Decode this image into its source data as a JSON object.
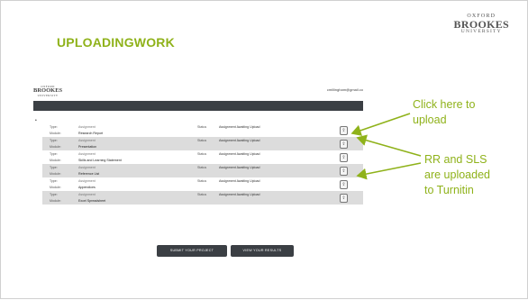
{
  "slide": {
    "title": "UPLOADINGWORK",
    "logo": {
      "line1": "OXFORD",
      "line2": "BROOKES",
      "line3": "UNIVERSITY"
    }
  },
  "screenshot": {
    "logo": {
      "line1": "OXFORD",
      "line2": "BROOKES",
      "line3": "UNIVERSITY"
    },
    "email": "cmillingham@gmail.co",
    "bullet": "•",
    "rows": [
      {
        "type_label": "Type:",
        "type_value": "Assignment",
        "module_label": "Module:",
        "module_value": "Research Report",
        "status_label": "Status",
        "status_value": "Assignment Awaiting Upload"
      },
      {
        "type_label": "Type:",
        "type_value": "Assignment",
        "module_label": "Module:",
        "module_value": "Presentation",
        "status_label": "Status",
        "status_value": "Assignment Awaiting Upload"
      },
      {
        "type_label": "Type:",
        "type_value": "Assignment",
        "module_label": "Module:",
        "module_value": "Skills and Learning Statement",
        "status_label": "Status",
        "status_value": "Assignment Awaiting Upload"
      },
      {
        "type_label": "Type:",
        "type_value": "Assignment",
        "module_label": "Module:",
        "module_value": "Reference List",
        "status_label": "Status",
        "status_value": "Assignment Awaiting Upload"
      },
      {
        "type_label": "Type:",
        "type_value": "Assignment",
        "module_label": "Module:",
        "module_value": "Appendices",
        "status_label": "Status",
        "status_value": "Assignment Awaiting Upload"
      },
      {
        "type_label": "Type:",
        "type_value": "Assignment",
        "module_label": "Module:",
        "module_value": "Excel Spreadsheet",
        "status_label": "Status",
        "status_value": "Assignment Awaiting Upload"
      }
    ],
    "buttons": {
      "submit": "SUBMIT YOUR PROJECT",
      "results": "VIEW YOUR RESULTS"
    }
  },
  "callouts": {
    "upload": [
      "Click here to",
      "upload"
    ],
    "turnitin": [
      "RR and SLS",
      "are uploaded",
      "to Turnitin"
    ]
  },
  "colors": {
    "accent": "#8fb21a",
    "dark_bar": "#3b3f44",
    "row_grey": "#dcdcdc"
  }
}
